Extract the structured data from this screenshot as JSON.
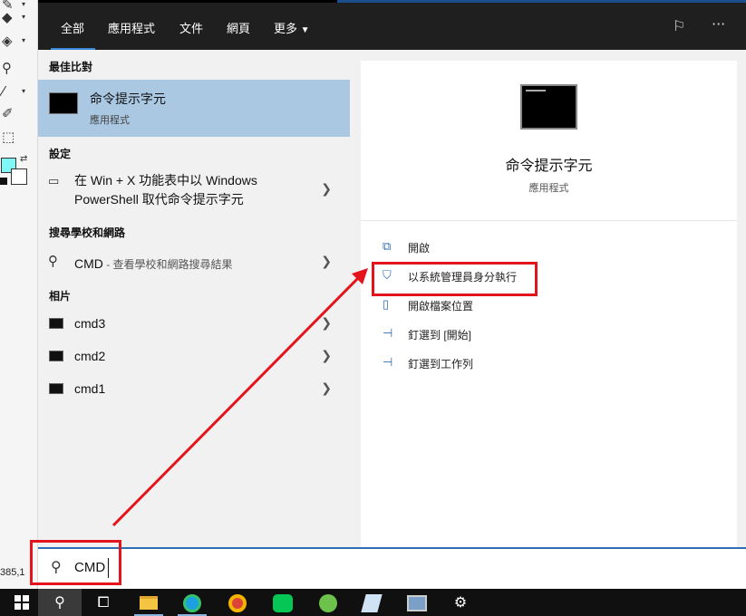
{
  "tabs": [
    "全部",
    "應用程式",
    "文件",
    "網頁",
    "更多"
  ],
  "sections": {
    "best_match": "最佳比對",
    "settings": "設定",
    "web": "搜尋學校和網路",
    "photos": "相片"
  },
  "best_result": {
    "title": "命令提示字元",
    "subtitle": "應用程式"
  },
  "setting_item": {
    "line1": "在 Win + X 功能表中以 Windows",
    "line2": "PowerShell 取代命令提示字元"
  },
  "web_item": {
    "title": "CMD",
    "suffix": " - 查看學校和網路搜尋結果"
  },
  "photos": [
    "cmd3",
    "cmd2",
    "cmd1"
  ],
  "preview": {
    "title": "命令提示字元",
    "subtitle": "應用程式",
    "actions": [
      "開啟",
      "以系統管理員身分執行",
      "開啟檔案位置",
      "釘選到 [開始]",
      "釘選到工作列"
    ]
  },
  "search": {
    "value": "CMD"
  },
  "coord_readout": "385,1",
  "colors": {
    "accent": "#2d6fb7",
    "selection": "#aac8e2",
    "annotation": "#e4141c",
    "dark_bar": "#1f1f1f"
  },
  "icons": [
    "pencil-icon",
    "fill-icon",
    "magnifier-icon",
    "eyedropper-icon",
    "brush-icon",
    "select-icon",
    "feedback-icon",
    "more-icon",
    "windows-icon",
    "search-icon",
    "task-view-icon",
    "file-explorer-icon",
    "edge-icon",
    "chrome-icon",
    "line-icon",
    "app-icon",
    "notepad-icon",
    "photos-icon",
    "settings-icon"
  ]
}
